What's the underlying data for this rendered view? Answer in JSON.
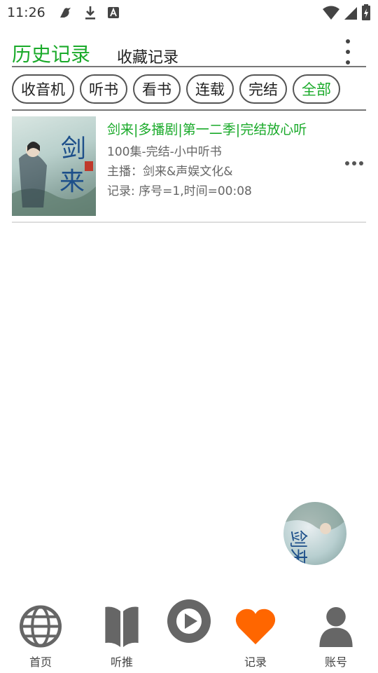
{
  "status_bar": {
    "time": "11:26"
  },
  "header": {
    "history_tab": "历史记录",
    "favorites_tab": "收藏记录"
  },
  "filters": [
    {
      "label": "收音机",
      "active": false
    },
    {
      "label": "听书",
      "active": false
    },
    {
      "label": "看书",
      "active": false
    },
    {
      "label": "连载",
      "active": false
    },
    {
      "label": "完结",
      "active": false
    },
    {
      "label": "全部",
      "active": true
    }
  ],
  "history": [
    {
      "title": "剑来|多播剧|第一二季|完结放心听",
      "subtitle": "100集-完结-小中听书",
      "host": "主播：剑来&声娱文化&",
      "record": "记录: 序号=1,时间=00:08",
      "cover_text": "剑来"
    }
  ],
  "nav": {
    "home": "首页",
    "recommend": "听推",
    "records": "记录",
    "account": "账号"
  },
  "colors": {
    "accent_green": "#1aaa2a",
    "accent_orange": "#ff6600",
    "icon_gray": "#666666"
  }
}
